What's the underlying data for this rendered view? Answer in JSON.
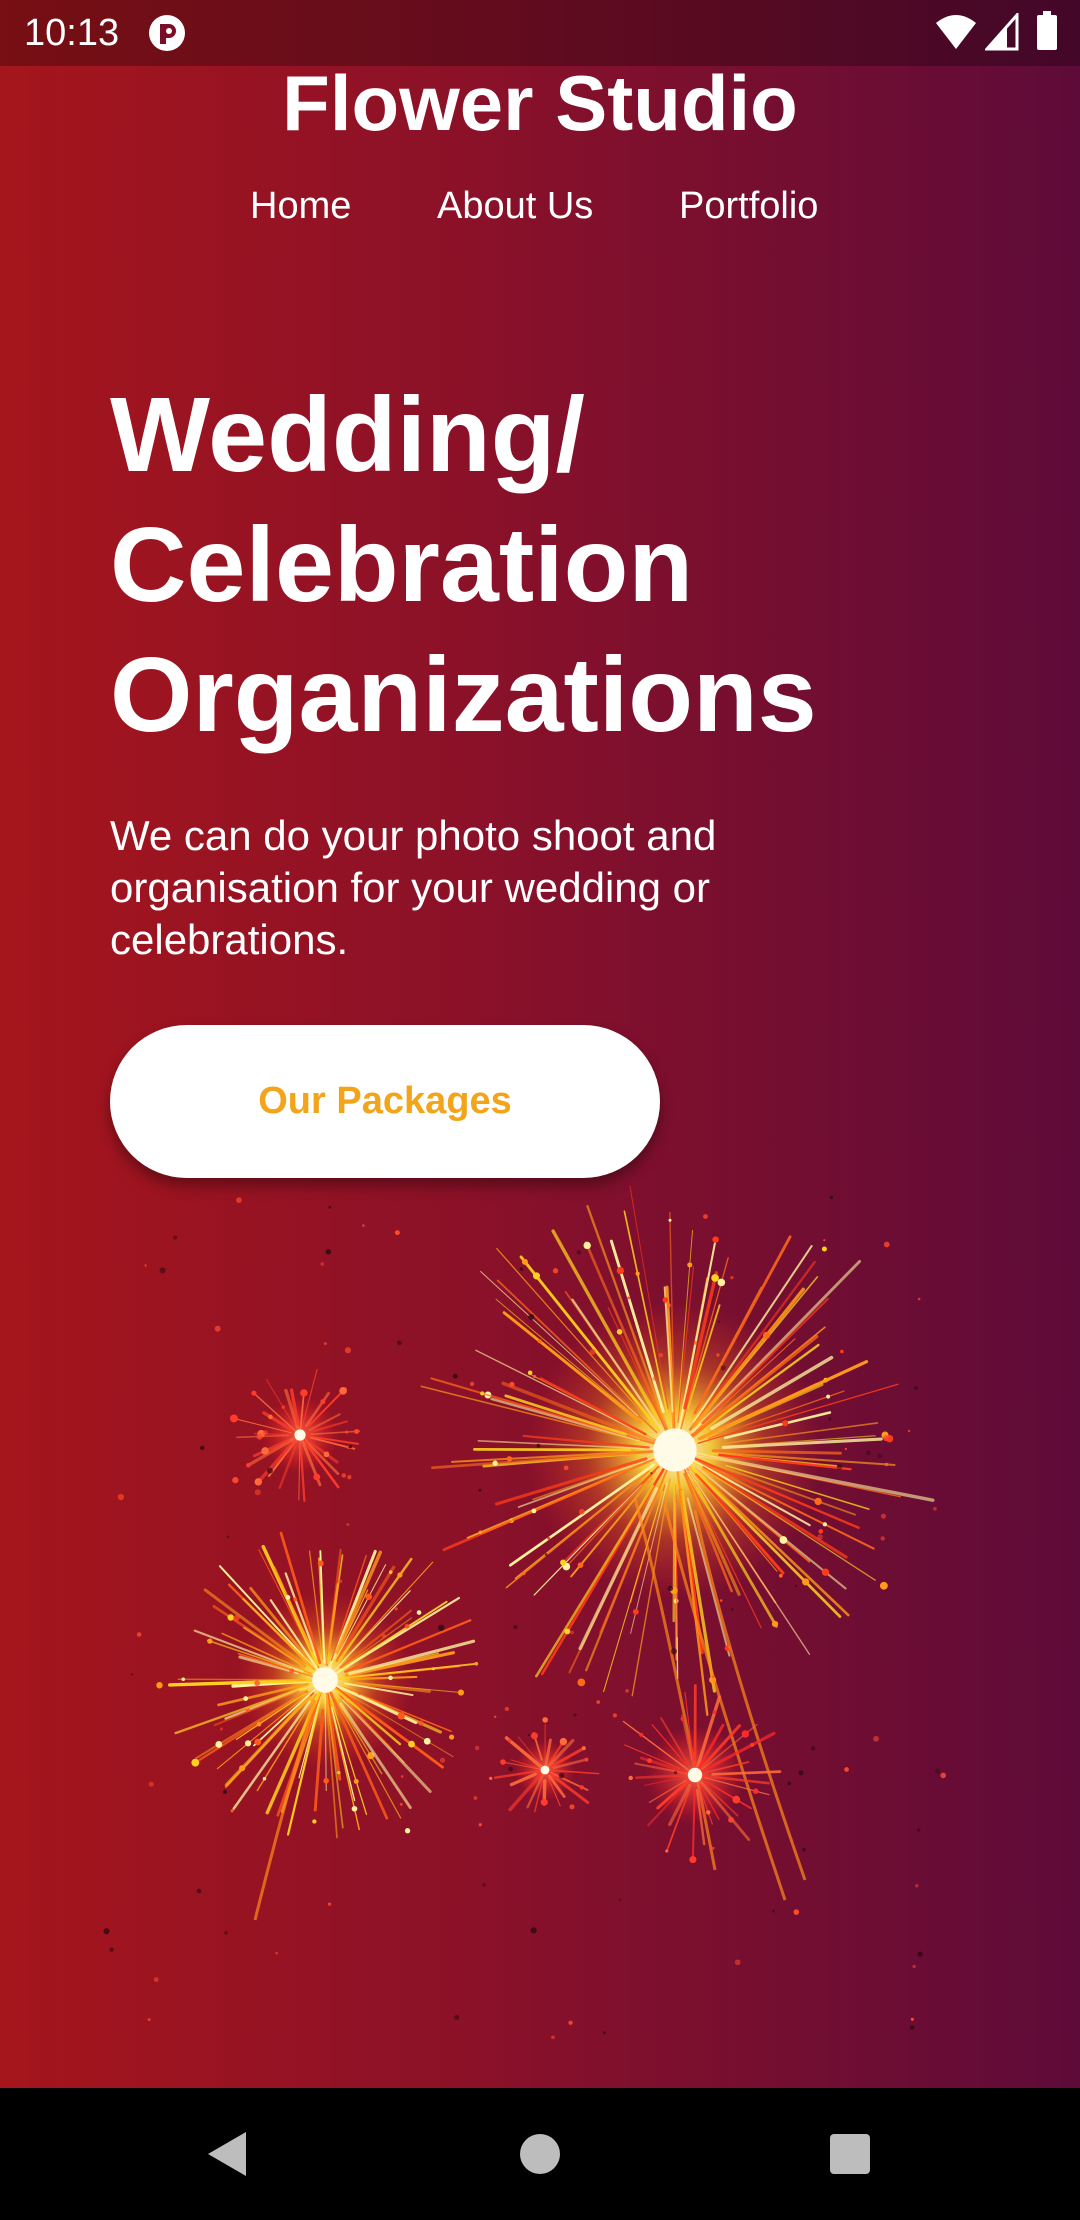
{
  "status_bar": {
    "time": "10:13",
    "app_icon": "notification-app-icon",
    "wifi_icon": "wifi-icon",
    "signal_icon": "cell-signal-icon",
    "battery_icon": "battery-icon"
  },
  "header": {
    "title": "Flower Studio",
    "nav": [
      {
        "label": "Home"
      },
      {
        "label": "About Us"
      },
      {
        "label": "Portfolio"
      }
    ]
  },
  "hero": {
    "heading_line1": "Wedding/",
    "heading_line2": "Celebration",
    "heading_line3": "Organizations",
    "description": "We can do your photo shoot and organisation for your wedding or celebrations.",
    "button_label": "Our Packages",
    "illustration": "fireworks-illustration"
  },
  "system_nav": {
    "back_icon": "back-triangle-icon",
    "home_icon": "home-circle-icon",
    "recents_icon": "recents-square-icon"
  },
  "colors": {
    "gradient_start": "#a5151c",
    "gradient_mid": "#8a1129",
    "gradient_end": "#5e0b39",
    "button_text": "#f2a51a",
    "button_bg": "#ffffff"
  }
}
